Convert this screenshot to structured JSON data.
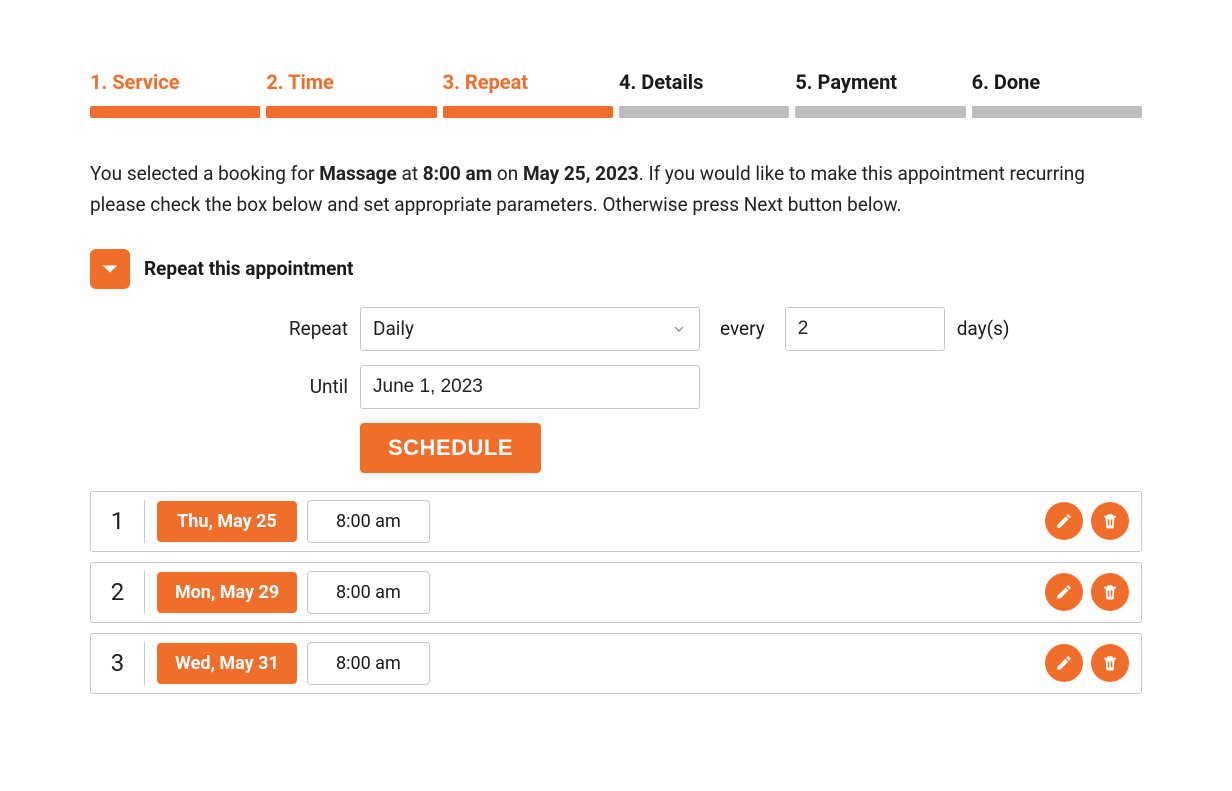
{
  "steps": [
    {
      "label": "1. Service",
      "active": true
    },
    {
      "label": "2. Time",
      "active": true
    },
    {
      "label": "3. Repeat",
      "active": true
    },
    {
      "label": "4. Details",
      "active": false
    },
    {
      "label": "5. Payment",
      "active": false
    },
    {
      "label": "6. Done",
      "active": false
    }
  ],
  "summary": {
    "prefix": "You selected a booking for ",
    "service": "Massage",
    "at": " at ",
    "time": "8:00 am",
    "on": " on ",
    "date": "May 25, 2023",
    "suffix": ". If you would like to make this appointment recurring please check the box below and set appropriate parameters. Otherwise press Next button below."
  },
  "repeat": {
    "title": "Repeat this appointment",
    "repeat_label": "Repeat",
    "repeat_value": "Daily",
    "every_label": "every",
    "every_value": "2",
    "units_label": "day(s)",
    "until_label": "Until",
    "until_value": "June 1, 2023",
    "schedule_label": "Schedule"
  },
  "schedule": [
    {
      "n": "1",
      "date": "Thu, May 25",
      "time": "8:00 am"
    },
    {
      "n": "2",
      "date": "Mon, May 29",
      "time": "8:00 am"
    },
    {
      "n": "3",
      "date": "Wed, May 31",
      "time": "8:00 am"
    }
  ],
  "colors": {
    "accent": "#F16E2A"
  }
}
